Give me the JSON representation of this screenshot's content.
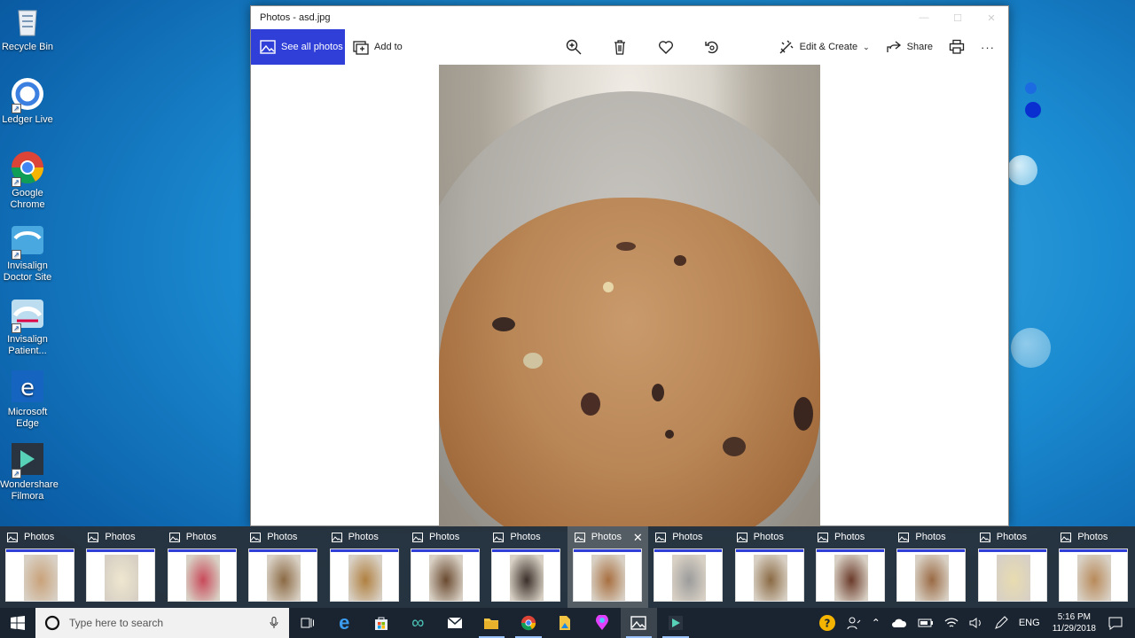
{
  "desktop": {
    "icons": [
      {
        "label": "Recycle Bin"
      },
      {
        "label": "Ledger Live"
      },
      {
        "label": "Google Chrome"
      },
      {
        "label": "Invisalign Doctor Site"
      },
      {
        "label": "Invisalign Patient..."
      },
      {
        "label": "Microsoft Edge"
      },
      {
        "label": "Wondershare Filmora"
      }
    ]
  },
  "window": {
    "title": "Photos - asd.jpg",
    "toolbar": {
      "see_all_photos": "See all photos",
      "add_to": "Add to",
      "edit_create": "Edit & Create",
      "share": "Share",
      "more": "···"
    }
  },
  "thumbnails": {
    "items": [
      {
        "label": "Photos"
      },
      {
        "label": "Photos"
      },
      {
        "label": "Photos"
      },
      {
        "label": "Photos"
      },
      {
        "label": "Photos"
      },
      {
        "label": "Photos"
      },
      {
        "label": "Photos"
      },
      {
        "label": "Photos"
      },
      {
        "label": "Photos"
      },
      {
        "label": "Photos"
      },
      {
        "label": "Photos"
      },
      {
        "label": "Photos"
      },
      {
        "label": "Photos"
      },
      {
        "label": "Photos"
      }
    ],
    "active_index": 7
  },
  "taskbar": {
    "search_placeholder": "Type here to search",
    "language": "ENG",
    "time": "5:16 PM",
    "date": "11/29/2018"
  },
  "colors": {
    "accent": "#2f3fd8",
    "taskbar": "#1a2430",
    "thumbbar": "#28303a"
  }
}
